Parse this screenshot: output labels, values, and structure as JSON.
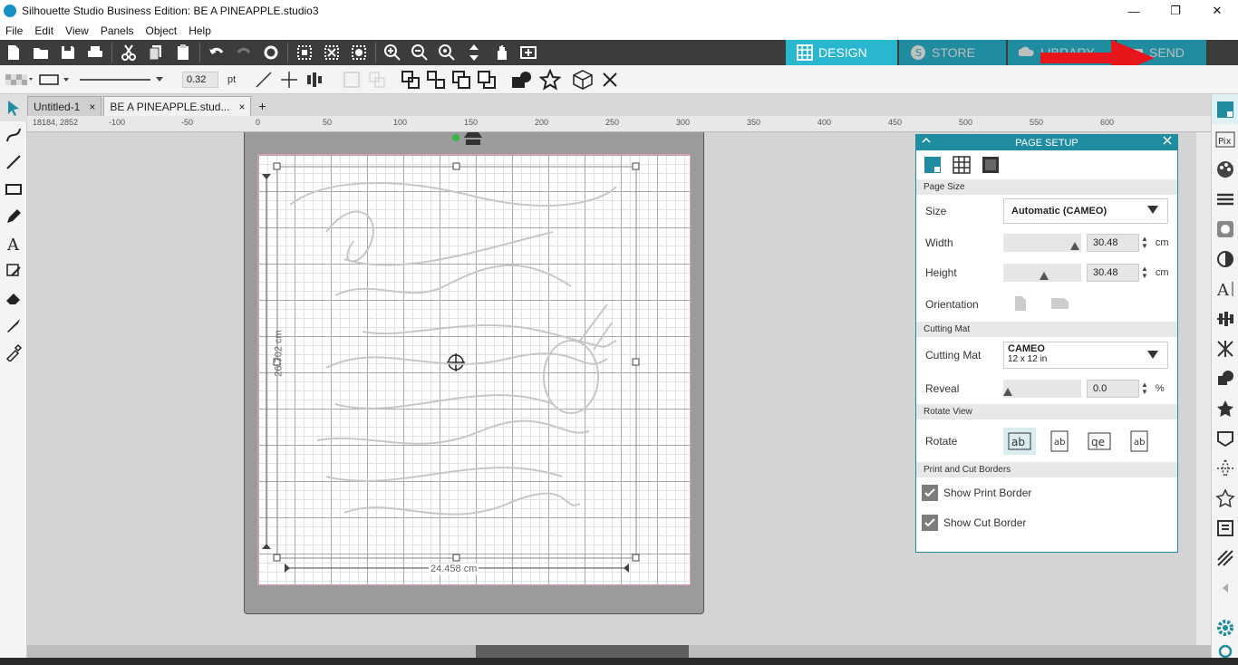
{
  "window": {
    "title": "Silhouette Studio Business Edition: BE A PINEAPPLE.studio3",
    "minimize": "—",
    "maximize": "❐",
    "close": "✕"
  },
  "menu": [
    "File",
    "Edit",
    "View",
    "Panels",
    "Object",
    "Help"
  ],
  "tabs": {
    "design": "DESIGN",
    "store": "STORE",
    "library": "LIBRARY",
    "send": "SEND"
  },
  "toolbar2": {
    "line_width": "0.32",
    "line_unit": "pt"
  },
  "doc_tabs": [
    {
      "label": "Untitled-1",
      "close": "×"
    },
    {
      "label": "BE A PINEAPPLE.stud...",
      "close": "×"
    }
  ],
  "doc_tab_add": "+",
  "ruler": {
    "coords": "18184, 2852",
    "labels": [
      "-100",
      "-50",
      "0",
      "50",
      "100",
      "150",
      "200",
      "250",
      "300",
      "350",
      "400",
      "450",
      "500",
      "550",
      "600"
    ]
  },
  "canvas": {
    "height_dim": "26.702 cm",
    "width_dim": "24.458 cm"
  },
  "page_setup": {
    "title": "PAGE SETUP",
    "sections": {
      "page_size": "Page Size",
      "cutting_mat": "Cutting Mat",
      "rotate_view": "Rotate View",
      "borders": "Print and Cut Borders"
    },
    "size_label": "Size",
    "size_value": "Automatic (CAMEO)",
    "width_label": "Width",
    "width_value": "30.48",
    "height_label": "Height",
    "height_value": "30.48",
    "unit": "cm",
    "orientation_label": "Orientation",
    "mat_label": "Cutting Mat",
    "mat_name": "CAMEO",
    "mat_size": "12 x 12 in",
    "reveal_label": "Reveal",
    "reveal_value": "0.0",
    "reveal_unit": "%",
    "rotate_label": "Rotate",
    "show_print_border": "Show Print Border",
    "show_cut_border": "Show Cut Border"
  },
  "colors": {
    "accent": "#29b6cf",
    "tab_inactive": "#1f8ca0",
    "toolbar_dark": "#3c3c3c",
    "annotation_red": "#e8151b"
  }
}
